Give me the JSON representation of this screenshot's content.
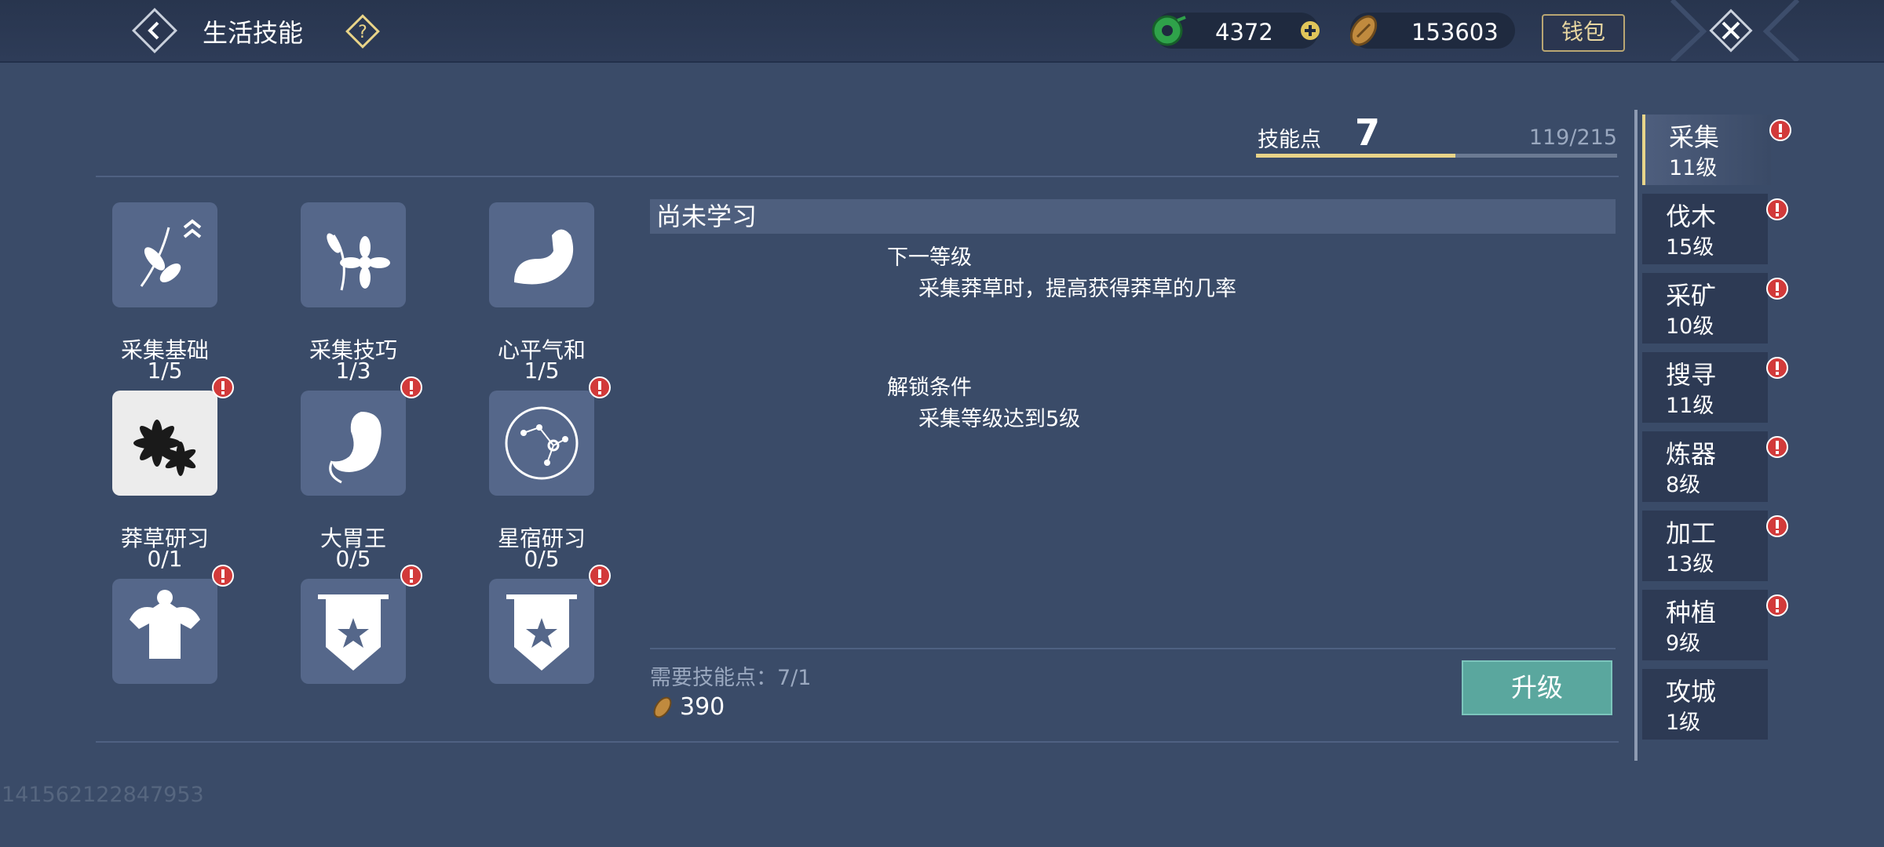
{
  "header": {
    "title": "生活技能",
    "jade": "4372",
    "coins": "153603",
    "wallet_label": "钱包"
  },
  "points": {
    "label": "技能点",
    "value": "7",
    "progress_text": "119/215",
    "progress": 0.553
  },
  "skills": [
    {
      "name": "采集基础",
      "level": "1/5",
      "icon": "herb-leaf-icon",
      "alert": false
    },
    {
      "name": "采集技巧",
      "level": "1/3",
      "icon": "flower-icon",
      "alert": false
    },
    {
      "name": "心平气和",
      "level": "1/5",
      "icon": "muscle-arm-icon",
      "alert": false
    },
    {
      "name": "莽草研习",
      "level": "0/1",
      "icon": "star-anise-icon",
      "alert": true
    },
    {
      "name": "大胃王",
      "level": "0/5",
      "icon": "stomach-icon",
      "alert": true
    },
    {
      "name": "星宿研习",
      "level": "0/5",
      "icon": "constellation-icon",
      "alert": true
    },
    {
      "name": "",
      "level": "",
      "icon": "torso-icon",
      "alert": true
    },
    {
      "name": "",
      "level": "",
      "icon": "banner-star-icon",
      "alert": true
    },
    {
      "name": "",
      "level": "",
      "icon": "banner-star-icon",
      "alert": true
    }
  ],
  "detail": {
    "status": "尚未学习",
    "next_level_label": "下一等级",
    "next_level_desc": "采集莽草时，提高获得莽草的几率",
    "unlock_label": "解锁条件",
    "unlock_desc": "采集等级达到5级",
    "required_points": "需要技能点：7/1",
    "cost": "390",
    "upgrade_label": "升级"
  },
  "player_id": "141562122847953",
  "categories": [
    {
      "name": "采集",
      "level": "11级",
      "active": true,
      "alert": true
    },
    {
      "name": "伐木",
      "level": "15级",
      "active": false,
      "alert": true
    },
    {
      "name": "采矿",
      "level": "10级",
      "active": false,
      "alert": true
    },
    {
      "name": "搜寻",
      "level": "11级",
      "active": false,
      "alert": true
    },
    {
      "name": "炼器",
      "level": "8级",
      "active": false,
      "alert": true
    },
    {
      "name": "加工",
      "level": "13级",
      "active": false,
      "alert": true
    },
    {
      "name": "种植",
      "level": "9级",
      "active": false,
      "alert": true
    },
    {
      "name": "攻城",
      "level": "1级",
      "active": false,
      "alert": false
    }
  ],
  "colors": {
    "background": "#3a4b68",
    "accent_gold": "#e9d488",
    "alert_red": "#d23a3a",
    "upgrade_teal": "#5aa79e"
  }
}
